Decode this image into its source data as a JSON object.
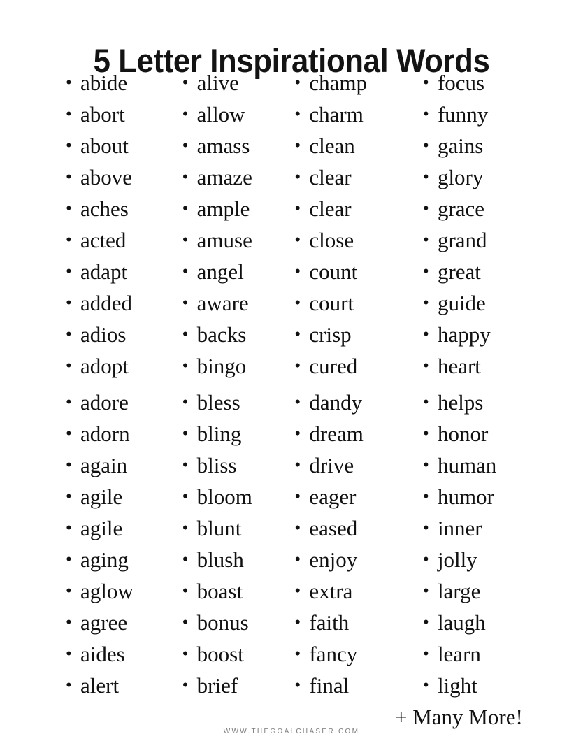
{
  "document": {
    "title": "5 Letter Inspirational Words",
    "background_color": "#ffffff",
    "text_color": "#111111",
    "bullet_glyph": "•"
  },
  "columns": [
    {
      "name": "column-1",
      "block_1": [
        "abide",
        "abort",
        "about",
        "above",
        "aches",
        "acted",
        "adapt",
        "added",
        "adios",
        "adopt"
      ],
      "block_2": [
        "adore",
        "adorn",
        "again",
        "agile",
        "agile",
        "aging",
        "aglow",
        "agree",
        "aides",
        "alert"
      ]
    },
    {
      "name": "column-2",
      "block_1": [
        "alive",
        "allow",
        "amass",
        "amaze",
        "ample",
        "amuse",
        "angel",
        "aware",
        "backs",
        "bingo"
      ],
      "block_2": [
        "bless",
        "bling",
        "bliss",
        "bloom",
        "blunt",
        "blush",
        "boast",
        "bonus",
        "boost",
        "brief"
      ]
    },
    {
      "name": "column-3",
      "block_1": [
        "champ",
        "charm",
        "clean",
        "clear",
        "clear",
        "close",
        "count",
        "court",
        "crisp",
        "cured"
      ],
      "block_2": [
        "dandy",
        "dream",
        "drive",
        "eager",
        "eased",
        "enjoy",
        "extra",
        "faith",
        "fancy",
        "final"
      ]
    },
    {
      "name": "column-4",
      "block_1": [
        "focus",
        "funny",
        "gains",
        "glory",
        "grace",
        "grand",
        "great",
        "guide",
        "happy",
        "heart"
      ],
      "block_2": [
        "helps",
        "honor",
        "human",
        "humor",
        "inner",
        "jolly",
        "large",
        "laugh",
        "learn",
        "light"
      ]
    }
  ],
  "footer": {
    "many_more": "+ Many More!",
    "watermark": "WWW.THEGOALCHASER.COM",
    "watermark_color": "#7b7b7b"
  }
}
